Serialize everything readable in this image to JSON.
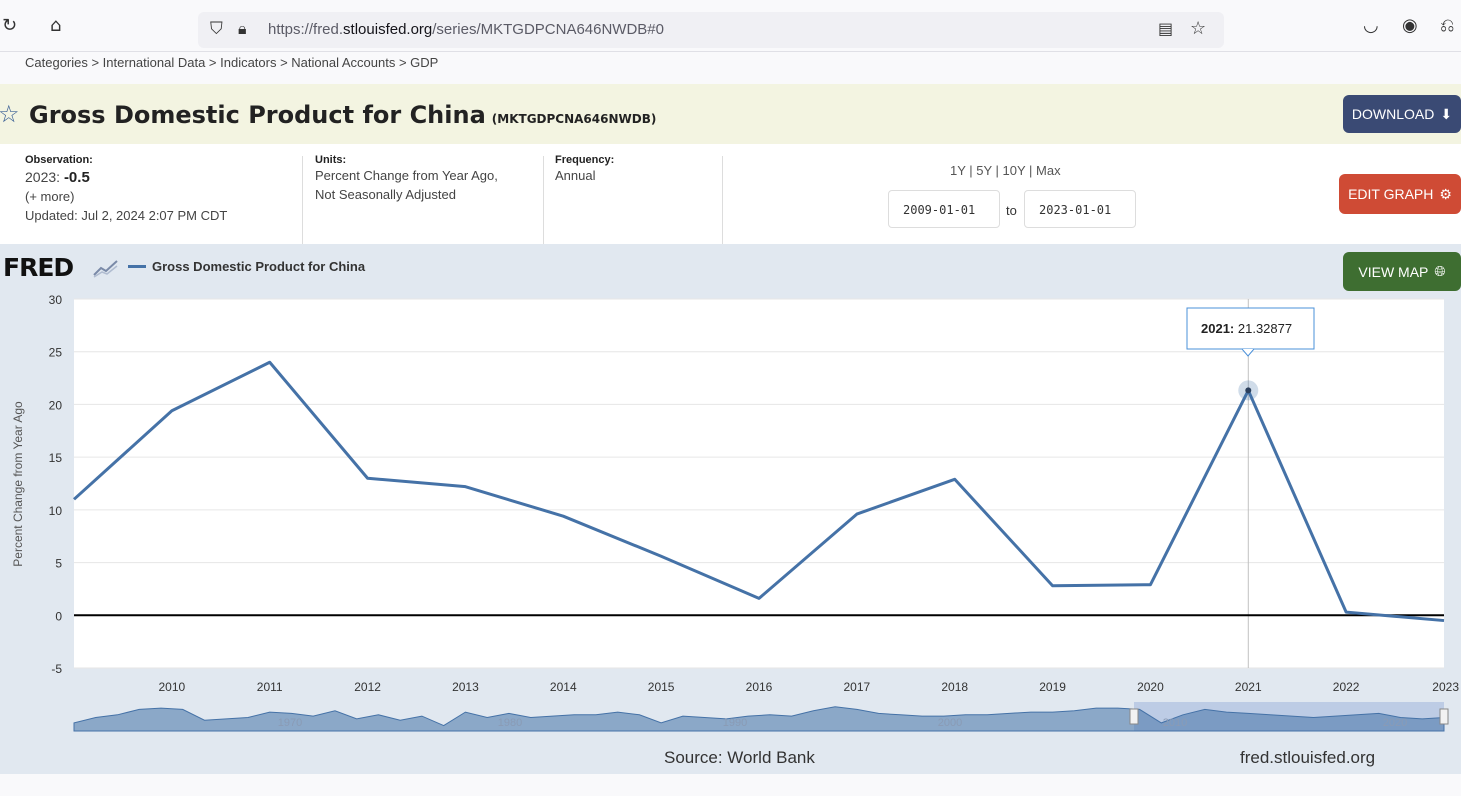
{
  "browser": {
    "url_prefix": "https://fred.",
    "url_domain": "stlouisfed.org",
    "url_path": "/series/MKTGDPCNA646NWDB#0"
  },
  "breadcrumb": "Categories > International Data > Indicators > National Accounts > GDP",
  "title": {
    "main": "Gross Domestic Product for China",
    "code": "(MKTGDPCNA646NWDB)"
  },
  "buttons": {
    "download": "DOWNLOAD",
    "edit_graph": "EDIT GRAPH",
    "view_map": "VIEW MAP"
  },
  "observation": {
    "label": "Observation:",
    "year": "2023:",
    "value": "-0.5",
    "more": "(+ more)",
    "updated": "Updated: Jul 2, 2024 2:07 PM CDT"
  },
  "units": {
    "label": "Units:",
    "line1": "Percent Change from Year Ago,",
    "line2": "Not Seasonally Adjusted"
  },
  "frequency": {
    "label": "Frequency:",
    "value": "Annual"
  },
  "range": {
    "links": "1Y | 5Y | 10Y | Max",
    "start": "2009-01-01",
    "to": "to",
    "end": "2023-01-01"
  },
  "fred_logo": "FRED",
  "legend_label": "Gross Domestic Product for China",
  "tooltip": {
    "year": "2021:",
    "value": "21.32877"
  },
  "footer": {
    "source": "Source: World Bank",
    "site": "fred.stlouisfed.org"
  },
  "colors": {
    "line": "#4572a7",
    "download_btn": "#3a4a74",
    "edit_btn": "#cf4b35",
    "map_btn": "#3e6e31"
  },
  "chart_data": {
    "type": "line",
    "x": [
      2009,
      2010,
      2011,
      2012,
      2013,
      2014,
      2015,
      2016,
      2017,
      2018,
      2019,
      2020,
      2021,
      2022,
      2023
    ],
    "series": [
      {
        "name": "Gross Domestic Product for China",
        "values": [
          11.0,
          19.4,
          24.0,
          13.0,
          12.2,
          9.4,
          5.6,
          1.6,
          9.6,
          12.9,
          2.8,
          2.9,
          21.32877,
          0.3,
          -0.5
        ]
      }
    ],
    "x_ticks": [
      "2010",
      "2011",
      "2012",
      "2013",
      "2014",
      "2015",
      "2016",
      "2017",
      "2018",
      "2019",
      "2020",
      "2021",
      "2022",
      "2023"
    ],
    "y_ticks": [
      "30",
      "25",
      "20",
      "15",
      "10",
      "5",
      "0",
      "-5"
    ],
    "ylabel": "Percent Change from Year Ago",
    "ylim": [
      -5,
      30
    ],
    "xlim": [
      2009,
      2023
    ],
    "navigator_labels": [
      "1970",
      "1980",
      "1990",
      "2000",
      "2010",
      "2020"
    ],
    "grid": true,
    "legend": "top-left"
  }
}
